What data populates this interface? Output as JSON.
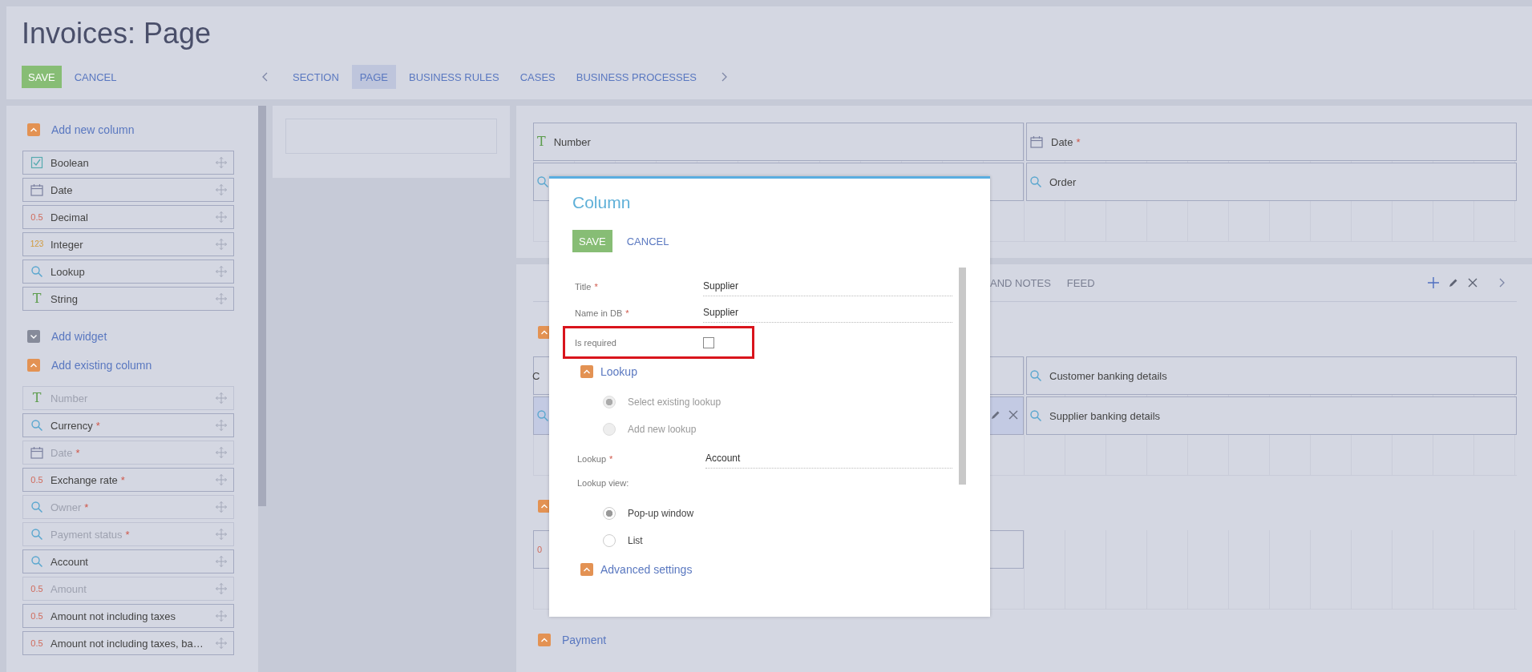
{
  "page": {
    "title": "Invoices: Page"
  },
  "toolbar": {
    "buttons": [
      {
        "label": "SAVE",
        "kind": "primary"
      },
      {
        "label": "CANCEL",
        "kind": "link"
      }
    ]
  },
  "tabs": [
    {
      "label": "SECTION",
      "selected": false
    },
    {
      "label": "PAGE",
      "selected": true
    },
    {
      "label": "BUSINESS RULES",
      "selected": false
    },
    {
      "label": "CASES",
      "selected": false
    },
    {
      "label": "BUSINESS PROCESSES",
      "selected": false
    }
  ],
  "sidebar": {
    "groups": [
      {
        "title": "Add new column",
        "expanded": true,
        "items": [
          {
            "label": "Boolean",
            "kind": "boolean",
            "disabled": false
          },
          {
            "label": "Date",
            "kind": "date",
            "disabled": false
          },
          {
            "label": "Decimal",
            "kind": "decimal",
            "icon_text": "0.5",
            "disabled": false
          },
          {
            "label": "Integer",
            "kind": "integer",
            "icon_text": "123",
            "disabled": false
          },
          {
            "label": "Lookup",
            "kind": "lookup",
            "disabled": false
          },
          {
            "label": "String",
            "kind": "string",
            "icon_text": "T",
            "disabled": false
          }
        ]
      },
      {
        "title": "Add widget",
        "expanded": false
      },
      {
        "title": "Add existing column",
        "expanded": true,
        "items": [
          {
            "label": "Number",
            "kind": "string",
            "icon_text": "T",
            "disabled": true
          },
          {
            "label": "Currency",
            "kind": "lookup",
            "mark": "*",
            "disabled": false
          },
          {
            "label": "Date",
            "kind": "date",
            "mark": "*",
            "disabled": true
          },
          {
            "label": "Exchange rate",
            "kind": "decimal",
            "icon_text": "0.5",
            "mark": "*",
            "disabled": false
          },
          {
            "label": "Owner",
            "kind": "lookup",
            "mark": "*",
            "disabled": true
          },
          {
            "label": "Payment status",
            "kind": "lookup",
            "mark": "*",
            "disabled": true
          },
          {
            "label": "Account",
            "kind": "lookup",
            "disabled": false
          },
          {
            "label": "Amount",
            "kind": "decimal",
            "icon_text": "0.5",
            "disabled": true
          },
          {
            "label": "Amount not including taxes",
            "kind": "decimal",
            "icon_text": "0.5",
            "disabled": false
          },
          {
            "label": "Amount not including taxes, ba…",
            "kind": "decimal",
            "icon_text": "0.5",
            "disabled": false
          }
        ]
      }
    ]
  },
  "header_card": {
    "rows": [
      [
        {
          "label": "Number",
          "kind": "string",
          "icon_text": "T",
          "selected": false
        },
        {
          "label": "Date",
          "kind": "date",
          "mark": "*",
          "selected": false
        }
      ],
      [
        {
          "kind": "lookup",
          "selected": false
        },
        {
          "label": "Order",
          "kind": "lookup",
          "selected": false
        }
      ]
    ]
  },
  "details_card": {
    "tabs": [
      {
        "label": "AND NOTES",
        "selected": false
      },
      {
        "label": "FEED",
        "selected": false
      }
    ],
    "groups": [
      {
        "expanded": true,
        "rows": [
          [
            {
              "label": "C",
              "kind": "plain",
              "selected": false
            },
            {
              "label": "Customer banking details",
              "kind": "lookup",
              "selected": false
            }
          ],
          [
            {
              "kind": "lookup",
              "selected": true
            },
            {
              "label": "Supplier banking details",
              "kind": "lookup",
              "selected": false
            }
          ]
        ]
      },
      {
        "expanded": true,
        "rows": [
          [
            {
              "kind": "decimal",
              "icon_text": "0",
              "selected": false
            }
          ]
        ]
      },
      {
        "title": "Payment",
        "expanded": true
      }
    ]
  },
  "dialog": {
    "title": "Column",
    "buttons": [
      {
        "label": "SAVE",
        "kind": "primary"
      },
      {
        "label": "CANCEL",
        "kind": "link"
      }
    ],
    "fields": [
      {
        "label": "Title",
        "mark": "*",
        "kind": "text",
        "value": "Supplier"
      },
      {
        "label": "Name in DB",
        "mark": "*",
        "kind": "text",
        "value": "Supplier"
      },
      {
        "label": "Is required",
        "kind": "checkbox",
        "checked": false,
        "highlighted": true
      }
    ],
    "lookup_section": {
      "title": "Lookup",
      "expanded": true,
      "source_options": [
        {
          "label": "Select existing lookup",
          "selected": true,
          "disabled": true
        },
        {
          "label": "Add new lookup",
          "selected": false,
          "disabled": true
        }
      ],
      "lookup_field": {
        "label": "Lookup",
        "mark": "*",
        "value": "Account"
      },
      "view_label": "Lookup view:",
      "view_options": [
        {
          "label": "Pop-up window",
          "selected": true,
          "disabled": false
        },
        {
          "label": "List",
          "selected": false,
          "disabled": false
        }
      ]
    },
    "advanced_section": {
      "title": "Advanced settings",
      "expanded": true
    }
  }
}
